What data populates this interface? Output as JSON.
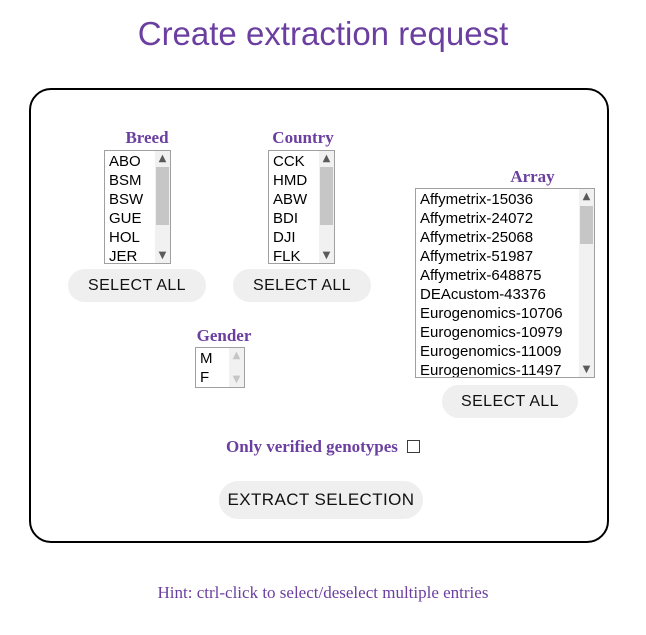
{
  "page": {
    "title": "Create extraction request",
    "hint": "Hint: ctrl-click to select/deselect multiple entries",
    "accent_color": "#6b3fa0",
    "card_border_color": "#000000",
    "button_bg": "#efefef"
  },
  "breed": {
    "label": "Breed",
    "options": [
      "ABO",
      "BSM",
      "BSW",
      "GUE",
      "HOL",
      "JER"
    ],
    "select_all_label": "SELECT ALL"
  },
  "country": {
    "label": "Country",
    "options": [
      "CCK",
      "HMD",
      "ABW",
      "BDI",
      "DJI",
      "FLK"
    ],
    "select_all_label": "SELECT ALL"
  },
  "gender": {
    "label": "Gender",
    "options": [
      "M",
      "F"
    ]
  },
  "array": {
    "label": "Array",
    "options": [
      "Affymetrix-15036",
      "Affymetrix-24072",
      "Affymetrix-25068",
      "Affymetrix-51987",
      "Affymetrix-648875",
      "DEAcustom-43376",
      "Eurogenomics-10706",
      "Eurogenomics-10979",
      "Eurogenomics-11009",
      "Eurogenomics-11497"
    ],
    "select_all_label": "SELECT ALL"
  },
  "verified": {
    "label": "Only verified genotypes",
    "checked": false
  },
  "extract": {
    "label": "EXTRACT SELECTION"
  }
}
